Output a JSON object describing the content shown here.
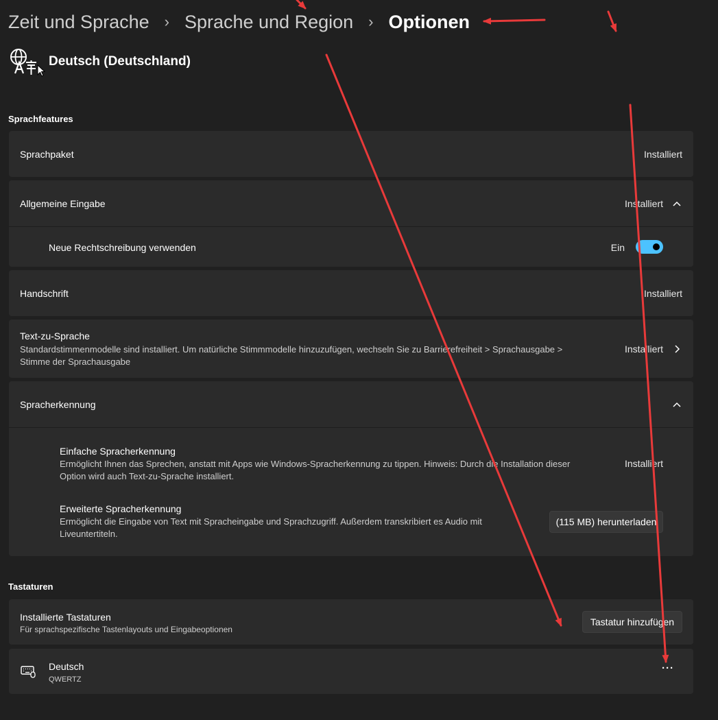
{
  "breadcrumb": {
    "item1": "Zeit und Sprache",
    "item2": "Sprache und Region",
    "current": "Optionen",
    "separator": "›"
  },
  "language": {
    "name": "Deutsch (Deutschland)",
    "icon": "language-icon"
  },
  "sections": {
    "speech_features": "Sprachfeatures",
    "keyboards": "Tastaturen"
  },
  "features": {
    "language_pack": {
      "label": "Sprachpaket",
      "status": "Installiert"
    },
    "general_input": {
      "label": "Allgemeine Eingabe",
      "status": "Installiert"
    },
    "spelling": {
      "label": "Neue Rechtschreibung verwenden",
      "toggle_label": "Ein",
      "toggle_on": true
    },
    "handwriting": {
      "label": "Handschrift",
      "status": "Installiert"
    },
    "tts": {
      "label": "Text-zu-Sprache",
      "description_line1": "Standardstimmenmodelle sind installiert. Um natürliche Stimmmodelle hinzuzufügen, wechseln Sie zu Barrierefreiheit > Sprachausgabe >",
      "description_line2": "Stimme der Sprachausgabe",
      "status": "Installiert"
    },
    "speech_recognition": {
      "label": "Spracherkennung",
      "basic": {
        "label": "Einfache Spracherkennung",
        "description_line1": "Ermöglicht Ihnen das Sprechen, anstatt mit Apps wie Windows-Spracherkennung zu tippen. Hinweis: Durch die Installation dieser",
        "description_line2": "Option wird auch Text-zu-Sprache installiert.",
        "status": "Installiert"
      },
      "advanced": {
        "label": "Erweiterte Spracherkennung",
        "description_line1": "Ermöglicht die Eingabe von Text mit Spracheingabe und Sprachzugriff. Außerdem transkribiert es Audio mit",
        "description_line2": "Liveuntertiteln.",
        "button": "(115 MB) herunterladen"
      }
    }
  },
  "keyboards": {
    "installed": {
      "label": "Installierte Tastaturen",
      "description": "Für sprachspezifische Tastenlayouts und Eingabeoptionen",
      "button": "Tastatur hinzufügen"
    },
    "items": [
      {
        "name": "Deutsch",
        "layout": "QWERTZ",
        "icon": "keyboard-icon",
        "more": "···"
      }
    ]
  },
  "colors": {
    "background": "#202020",
    "card": "#2b2b2b",
    "accent": "#4cc2ff",
    "annotation": "#e83a3a"
  }
}
